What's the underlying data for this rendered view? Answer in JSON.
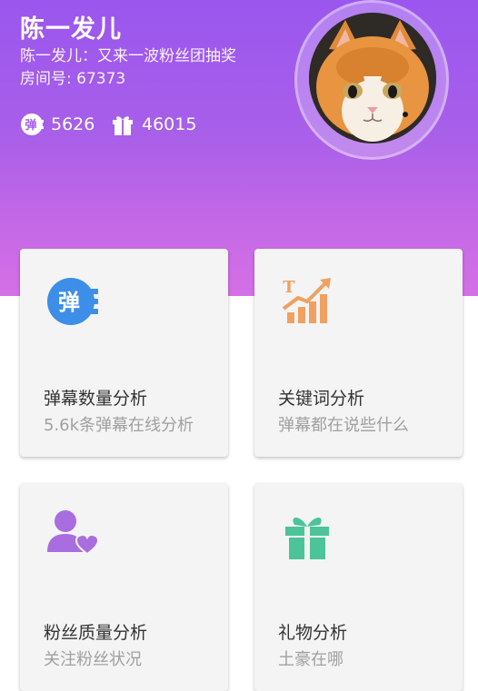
{
  "header": {
    "streamer_name": "陈一发儿",
    "room_title": "陈一发儿：又来一波粉丝团抽奖",
    "room_number": "房间号: 67373",
    "danmu_count": "5626",
    "gift_count": "46015",
    "danmu_badge_char": "弹"
  },
  "cards": [
    {
      "title": "弹幕数量分析",
      "subtitle": "5.6k条弹幕在线分析",
      "icon": "danmu-icon",
      "color": "#3d8ee8",
      "badge_char": "弹"
    },
    {
      "title": "关键词分析",
      "subtitle": "弹幕都在说些什么",
      "icon": "keyword-chart-icon",
      "color": "#f0a060",
      "badge_char": "T"
    },
    {
      "title": "粉丝质量分析",
      "subtitle": "关注粉丝状况",
      "icon": "user-heart-icon",
      "color": "#a86ee0"
    },
    {
      "title": "礼物分析",
      "subtitle": "土豪在哪",
      "icon": "gift-icon",
      "color": "#4cc499"
    }
  ]
}
